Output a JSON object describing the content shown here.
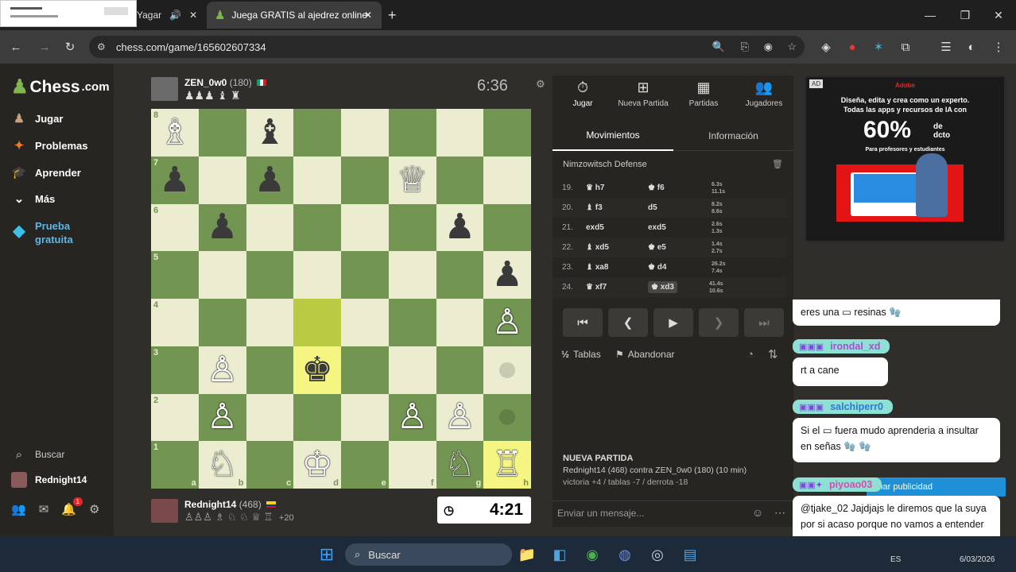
{
  "browser": {
    "tab1_label": "Yagar",
    "tab2_label": "Juega GRATIS al ajedrez online",
    "new_tab": "+",
    "url": "chess.com/game/165602607334",
    "win_min": "—",
    "win_max": "❐",
    "win_close": "✕"
  },
  "sidebar": {
    "logo": "Chess",
    "logo_suffix": ".com",
    "items": [
      {
        "label": "Jugar",
        "icon": "♟"
      },
      {
        "label": "Problemas",
        "icon": "✦"
      },
      {
        "label": "Aprender",
        "icon": "🎓"
      },
      {
        "label": "Más",
        "icon": "⌄"
      },
      {
        "label": "Prueba gratuita",
        "icon": "◆"
      }
    ],
    "search": "Buscar",
    "username": "Rednight14",
    "notif_count": "1"
  },
  "top_player": {
    "name": "ZEN_0w0",
    "rating": "(180)",
    "captured": "♟♟♟ ♝ ♜",
    "clock": "6:36"
  },
  "bottom_player": {
    "name": "Rednight14",
    "rating": "(468)",
    "captured": "♙♙♙ ♗ ♘ ♘ ♕ ♖",
    "advantage": "+20",
    "clock": "4:21"
  },
  "board": {
    "ranks": [
      "8",
      "7",
      "6",
      "5",
      "4",
      "3",
      "2",
      "1"
    ],
    "files": [
      "a",
      "b",
      "c",
      "d",
      "e",
      "f",
      "g",
      "h"
    ],
    "position": [
      [
        "wB",
        "",
        "bB",
        "",
        "",
        "",
        "",
        ""
      ],
      [
        "bP",
        "",
        "bP",
        "",
        "",
        "wQ",
        "",
        ""
      ],
      [
        "",
        "bP",
        "",
        "",
        "",
        "",
        "bP",
        ""
      ],
      [
        "",
        "",
        "",
        "",
        "",
        "",
        "",
        "bP"
      ],
      [
        "",
        "",
        "",
        "",
        "",
        "",
        "",
        "wP"
      ],
      [
        "",
        "wP",
        "",
        "bK",
        "",
        "",
        "",
        "dot"
      ],
      [
        "",
        "wP",
        "",
        "",
        "",
        "wP",
        "wP",
        "dotd"
      ],
      [
        "",
        "wN",
        "",
        "wK",
        "",
        "",
        "wN",
        "wR"
      ]
    ],
    "highlight_light": [
      "d3",
      "h1"
    ],
    "highlight_dark": [
      "d4"
    ]
  },
  "panel": {
    "tabs": [
      "Jugar",
      "Nueva Partida",
      "Partidas",
      "Jugadores"
    ],
    "subtabs": [
      "Movimientos",
      "Información"
    ],
    "opening": "Nimzowitsch Defense",
    "moves": [
      {
        "n": "19.",
        "w": "♛ h7",
        "b": "♚ f6",
        "tw": "6.3s",
        "tb": "11.1s"
      },
      {
        "n": "20.",
        "w": "♝ f3",
        "b": "d5",
        "tw": "8.2s",
        "tb": "8.6s"
      },
      {
        "n": "21.",
        "w": "exd5",
        "b": "exd5",
        "tw": "2.6s",
        "tb": "1.3s"
      },
      {
        "n": "22.",
        "w": "♝ xd5",
        "b": "♚ e5",
        "tw": "1.4s",
        "tb": "2.7s"
      },
      {
        "n": "23.",
        "w": "♝ xa8",
        "b": "♚ d4",
        "tw": "26.2s",
        "tb": "7.4s"
      },
      {
        "n": "24.",
        "w": "♛ xf7",
        "b": "♚ xd3",
        "tw": "41.4s",
        "tb": "10.6s"
      }
    ],
    "draw": "Tablas",
    "resign": "Abandonar",
    "new_game_title": "NUEVA PARTIDA",
    "new_game_line": "Rednight14 (468) contra ZEN_0w0 (180) (10 min)",
    "record": "victoria +4 / tablas -7 / derrota -18",
    "chat_placeholder": "Enviar un mensaje..."
  },
  "ad": {
    "tag": "AD",
    "brand": "Adobe",
    "line1": "Diseña, edita y crea como un experto.",
    "line2": "Todas las apps y recursos de IA con",
    "pct": "60%",
    "pct_suffix": "de dcto",
    "line3": "Para profesores y estudiantes"
  },
  "chat": {
    "msg1": "eres una ▭ resinas",
    "user2": "irondal_xd",
    "msg2": "rt a cane",
    "user3": "salchiperr0",
    "msg3": "Si el ▭ fuera mudo aprenderia a insultar en señas",
    "user4": "piyoao03",
    "behind": "inar publicidad",
    "msg4": "@tjake_02 Jajdjajs le diremos que la suya por si acaso porque no vamos a entender"
  },
  "taskbar": {
    "search": "Buscar",
    "lang": "ES",
    "date": "6/03/2026"
  }
}
